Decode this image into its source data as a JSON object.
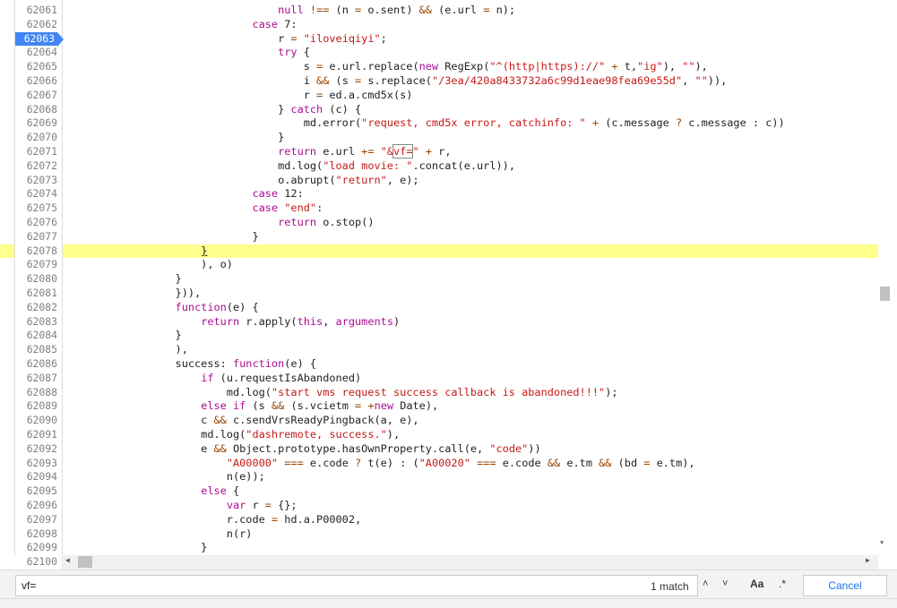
{
  "editor": {
    "current_line": "62078",
    "breakpoint_line": "62063",
    "lines": [
      {
        "n": "62061",
        "t": "                                null !== (n = o.sent) && (e.url = n);"
      },
      {
        "n": "62062",
        "t": "                            case 7:"
      },
      {
        "n": "62063",
        "t": "                                r = \"iloveiqiyi\";"
      },
      {
        "n": "62064",
        "t": "                                try {"
      },
      {
        "n": "62065",
        "t": "                                    s = e.url.replace(new RegExp(\"^(http|https)://\" + t,\"ig\"), \"\"),"
      },
      {
        "n": "62066",
        "t": "                                    i && (s = s.replace(\"/3ea/420a8433732a6c99d1eae98fea69e55d\", \"\")),"
      },
      {
        "n": "62067",
        "t": "                                    r = ed.a.cmd5x(s)"
      },
      {
        "n": "62068",
        "t": "                                } catch (c) {"
      },
      {
        "n": "62069",
        "t": "                                    md.error(\"request, cmd5x error, catchinfo: \" + (c.message ? c.message : c))"
      },
      {
        "n": "62070",
        "t": "                                }"
      },
      {
        "n": "62071",
        "t": "                                return e.url += \"&vf=\" + r,"
      },
      {
        "n": "62072",
        "t": "                                md.log(\"load movie: \".concat(e.url)),"
      },
      {
        "n": "62073",
        "t": "                                o.abrupt(\"return\", e);"
      },
      {
        "n": "62074",
        "t": "                            case 12:"
      },
      {
        "n": "62075",
        "t": "                            case \"end\":"
      },
      {
        "n": "62076",
        "t": "                                return o.stop()"
      },
      {
        "n": "62077",
        "t": "                            }"
      },
      {
        "n": "62078",
        "t": "                    }"
      },
      {
        "n": "62079",
        "t": "                    ), o)"
      },
      {
        "n": "62080",
        "t": "                }"
      },
      {
        "n": "62081",
        "t": "                })),"
      },
      {
        "n": "62082",
        "t": "                function(e) {"
      },
      {
        "n": "62083",
        "t": "                    return r.apply(this, arguments)"
      },
      {
        "n": "62084",
        "t": "                }"
      },
      {
        "n": "62085",
        "t": "                ),"
      },
      {
        "n": "62086",
        "t": "                success: function(e) {"
      },
      {
        "n": "62087",
        "t": "                    if (u.requestIsAbandoned)"
      },
      {
        "n": "62088",
        "t": "                        md.log(\"start vms request success callback is abandoned!!!\");"
      },
      {
        "n": "62089",
        "t": "                    else if (s && (s.vcietm = +new Date),"
      },
      {
        "n": "62090",
        "t": "                    c && c.sendVrsReadyPingback(a, e),"
      },
      {
        "n": "62091",
        "t": "                    md.log(\"dashremote, success.\"),"
      },
      {
        "n": "62092",
        "t": "                    e && Object.prototype.hasOwnProperty.call(e, \"code\"))"
      },
      {
        "n": "62093",
        "t": "                        \"A00000\" === e.code ? t(e) : (\"A00020\" === e.code && e.tm && (bd = e.tm),"
      },
      {
        "n": "62094",
        "t": "                        n(e));"
      },
      {
        "n": "62095",
        "t": "                    else {"
      },
      {
        "n": "62096",
        "t": "                        var r = {};"
      },
      {
        "n": "62097",
        "t": "                        r.code = hd.a.P00002,"
      },
      {
        "n": "62098",
        "t": "                        n(r)"
      },
      {
        "n": "62099",
        "t": "                    }"
      }
    ],
    "last_line_number": "62100"
  },
  "search": {
    "query": "vf=",
    "match_count": "1 match",
    "prev_icon": "chevron-up-icon",
    "next_icon": "chevron-down-icon",
    "case_label": "Aa",
    "regex_label": ".*",
    "cancel_label": "Cancel"
  },
  "colors": {
    "keyword": "#aa0d91",
    "string": "#c41a16",
    "highlight": "#ffff8c",
    "breakpoint": "#4285f4"
  }
}
